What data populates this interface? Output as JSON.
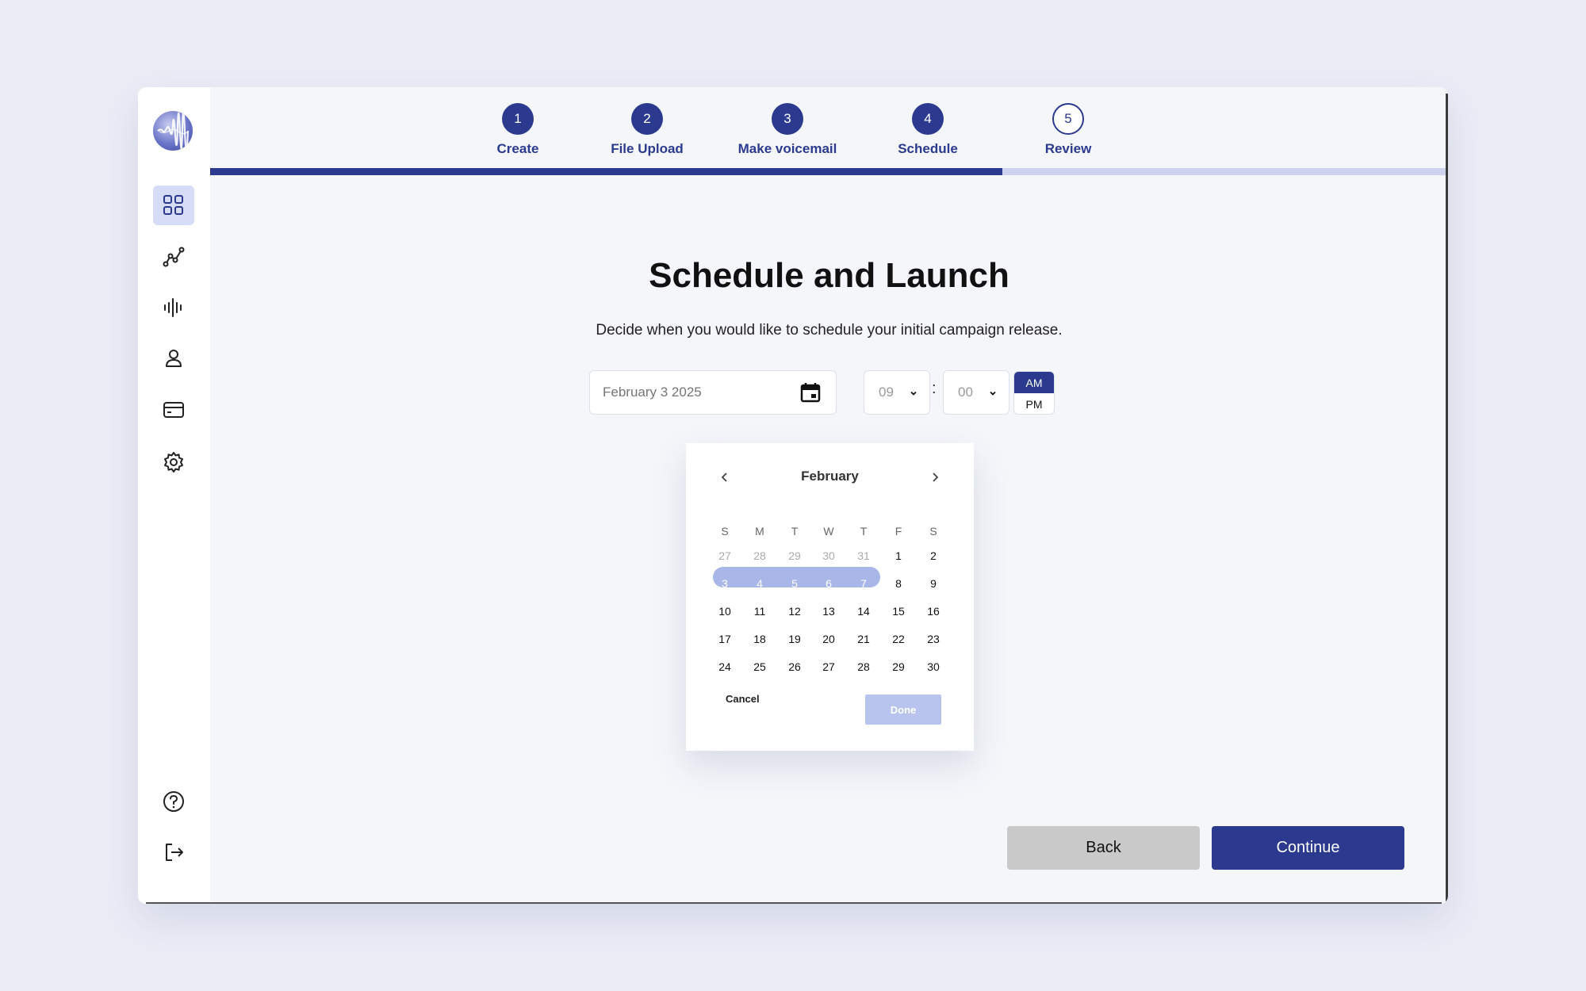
{
  "stepper": {
    "steps": [
      {
        "num": "1",
        "label": "Create",
        "state": "done"
      },
      {
        "num": "2",
        "label": "File Upload",
        "state": "done"
      },
      {
        "num": "3",
        "label": "Make voicemail",
        "state": "done"
      },
      {
        "num": "4",
        "label": "Schedule",
        "state": "current"
      },
      {
        "num": "5",
        "label": "Review",
        "state": "pending"
      }
    ],
    "progress_fraction": 0.64
  },
  "sidebar": {
    "items": [
      "dashboard-icon",
      "analytics-icon",
      "voicemail-icon",
      "contacts-icon",
      "billing-icon",
      "settings-icon"
    ],
    "bottom": [
      "help-icon",
      "logout-icon"
    ]
  },
  "main": {
    "title": "Schedule and Launch",
    "subtitle": "Decide when you would like to schedule your initial campaign release."
  },
  "schedule": {
    "date_placeholder": "February 3 2025",
    "hour": "09",
    "minute": "00",
    "colon": ":",
    "am": "AM",
    "pm": "PM",
    "selected_period": "AM"
  },
  "calendar": {
    "month": "February",
    "weekdays": [
      "S",
      "M",
      "T",
      "W",
      "T",
      "F",
      "S"
    ],
    "weeks": [
      [
        "27",
        "28",
        "29",
        "30",
        "31",
        "1",
        "2"
      ],
      [
        "3",
        "4",
        "5",
        "6",
        "7",
        "8",
        "9"
      ],
      [
        "10",
        "11",
        "12",
        "13",
        "14",
        "15",
        "16"
      ],
      [
        "17",
        "18",
        "19",
        "20",
        "21",
        "22",
        "23"
      ],
      [
        "24",
        "25",
        "26",
        "27",
        "28",
        "29",
        "30"
      ]
    ],
    "muted_first_row_count": 5,
    "selected_range": [
      "3",
      "7"
    ],
    "cancel_label": "Cancel",
    "done_label": "Done"
  },
  "actions": {
    "back_label": "Back",
    "continue_label": "Continue"
  },
  "colors": {
    "primary": "#2b3a8e",
    "progress_track": "#cdd3ef",
    "range_highlight": "#a9b6e8",
    "done_disabled": "#b9c4ee",
    "back_button": "#c9c9c9"
  }
}
